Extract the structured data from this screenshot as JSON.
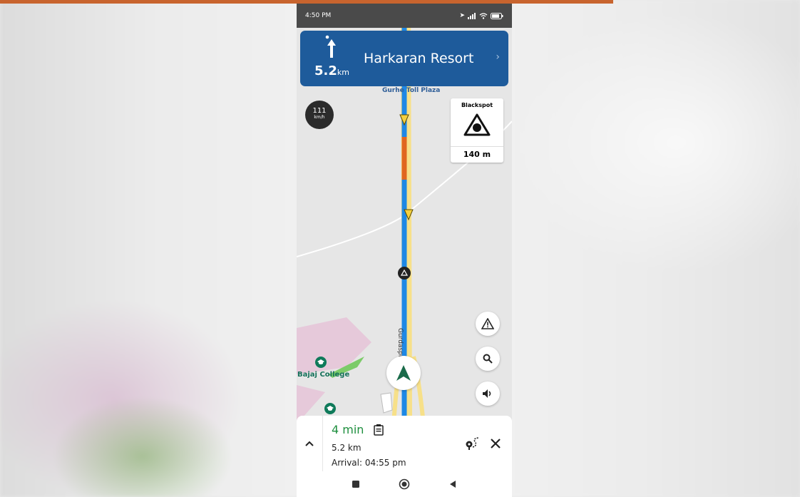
{
  "status_bar": {
    "time": "4:50 PM"
  },
  "nav_banner": {
    "distance_value": "5.2",
    "distance_unit": "km",
    "street": "Harkaran Resort"
  },
  "map": {
    "toll_label": "Gurhe Toll Plaza",
    "road_label": "Gurdaspur Road",
    "college_label": "Bajaj College"
  },
  "speed": {
    "value": "111",
    "unit": "km/h"
  },
  "blackspot": {
    "title": "Blackspot",
    "distance": "140 m"
  },
  "trip": {
    "eta": "4 min",
    "distance": "5.2 km",
    "arrival": "Arrival: 04:55 pm"
  },
  "colors": {
    "banner": "#1e5b9b",
    "route": "#1e88e5",
    "congestion": "#e0661f",
    "eta_green": "#1f8f3f"
  },
  "icons": [
    "hazard-icon",
    "search-icon",
    "volume-icon",
    "route-options-icon",
    "close-icon",
    "chevron-up-icon",
    "trip-summary-icon"
  ]
}
